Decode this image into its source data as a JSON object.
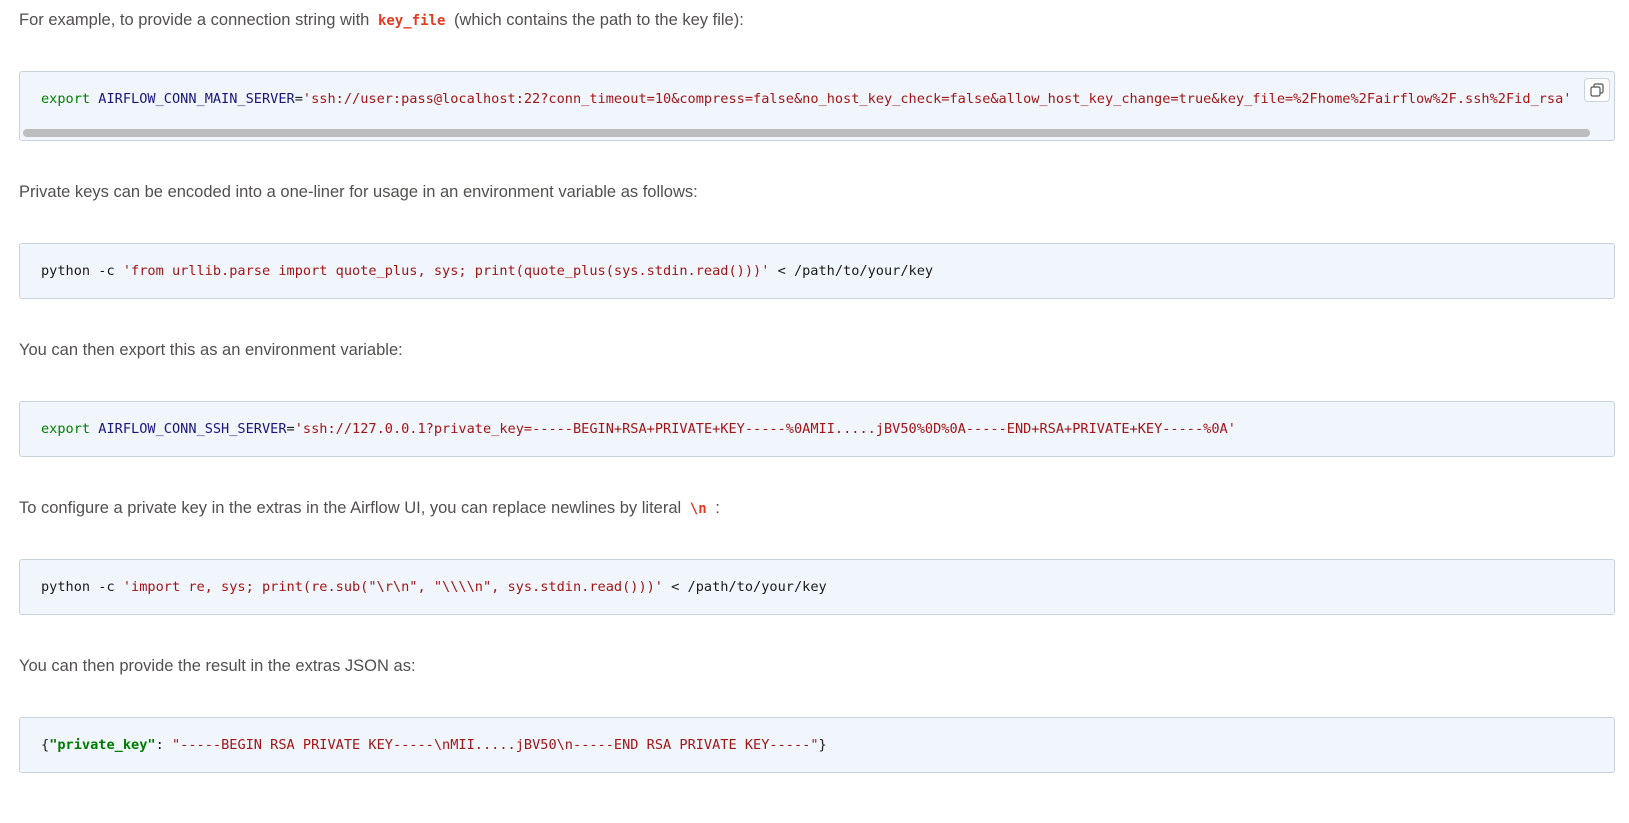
{
  "para1": {
    "before": "For example, to provide a connection string with ",
    "code": "key_file",
    "after": " (which contains the path to the key file):"
  },
  "code1": {
    "keyword": "export",
    "variable": "AIRFLOW_CONN_MAIN_SERVER",
    "operator": "=",
    "string": "'ssh://user:pass@localhost:22?conn_timeout=10&compress=false&no_host_key_check=false&allow_host_key_change=true&key_file=%2Fhome%2Fairflow%2F.ssh%2Fid_rsa'"
  },
  "para2": {
    "text": "Private keys can be encoded into a one-liner for usage in an environment variable as follows:"
  },
  "code2": {
    "command": "python -c ",
    "string": "'from urllib.parse import quote_plus, sys; print(quote_plus(sys.stdin.read()))'",
    "rest": " < /path/to/your/key"
  },
  "para3": {
    "text": "You can then export this as an environment variable:"
  },
  "code3": {
    "keyword": "export",
    "variable": "AIRFLOW_CONN_SSH_SERVER",
    "operator": "=",
    "string": "'ssh://127.0.0.1?private_key=-----BEGIN+RSA+PRIVATE+KEY-----%0AMII.....jBV50%0D%0A-----END+RSA+PRIVATE+KEY-----%0A'"
  },
  "para4": {
    "before": "To configure a private key in the extras in the Airflow UI, you can replace newlines by literal ",
    "code": "\\n",
    "after": " :"
  },
  "code4": {
    "command": "python -c ",
    "string": "'import re, sys; print(re.sub(\"\\r\\n\", \"\\\\\\\\n\", sys.stdin.read()))'",
    "rest": " < /path/to/your/key"
  },
  "para5": {
    "text": "You can then provide the result in the extras JSON as:"
  },
  "code5": {
    "open_brace": "{",
    "key": "\"private_key\"",
    "colon": ": ",
    "value": "\"-----BEGIN RSA PRIVATE KEY-----\\nMII.....jBV50\\n-----END RSA PRIVATE KEY-----\"",
    "close_brace": "}"
  },
  "icons": {
    "copy": "copy-icon"
  }
}
